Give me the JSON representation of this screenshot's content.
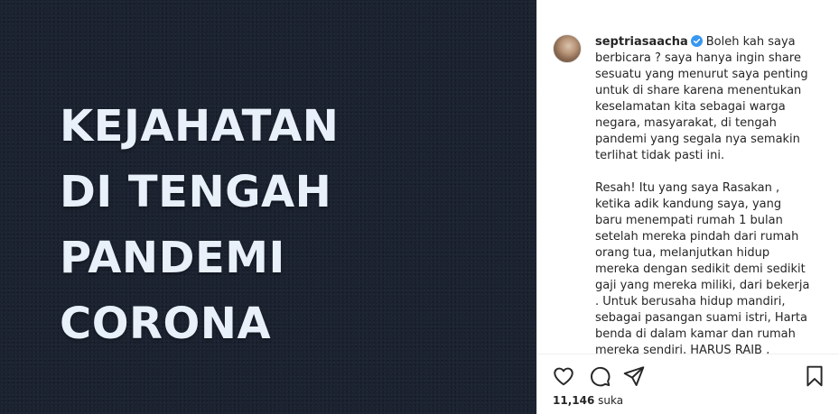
{
  "post": {
    "headline_lines": [
      "KEJAHATAN",
      "DI TENGAH",
      "PANDEMI",
      "CORONA"
    ]
  },
  "author": {
    "username": "septriasaacha",
    "verified": true
  },
  "caption": {
    "para1": "Boleh kah saya berbicara ? saya hanya ingin share sesuatu yang menurut saya penting untuk di share karena menentukan keselamatan kita sebagai warga negara, masyarakat, di tengah pandemi yang segala nya semakin terlihat tidak pasti ini.",
    "para2": "Resah! Itu yang saya Rasakan , ketika adik kandung saya, yang baru menempati rumah 1 bulan setelah mereka pindah dari rumah orang tua, melanjutkan hidup mereka dengan sedikit demi sedikit gaji yang mereka miliki, dari bekerja . Untuk berusaha hidup mandiri, sebagai pasangan suami istri, Harta benda di dalam kamar dan rumah mereka sendiri, HARUS RAIB , dikuras. Pencuri"
  },
  "actions": {
    "like_icon": "heart-icon",
    "comment_icon": "comment-icon",
    "share_icon": "send-icon",
    "save_icon": "bookmark-icon"
  },
  "likes": {
    "count": "11,146",
    "label": "suka"
  },
  "colors": {
    "image_background": "#1b2230",
    "headline_text": "#e8f0fa",
    "verified_badge": "#3897f0",
    "text": "#262626"
  }
}
